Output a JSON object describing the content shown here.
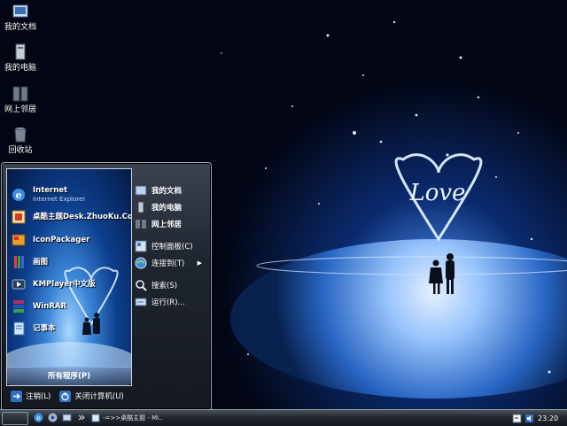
{
  "desktop": {
    "icons": [
      {
        "label": "我的文档",
        "icon": "my-documents-icon"
      },
      {
        "label": "我的电脑",
        "icon": "my-computer-icon"
      },
      {
        "label": "网上邻居",
        "icon": "network-places-icon"
      },
      {
        "label": "回收站",
        "icon": "recycle-bin-icon"
      }
    ],
    "wallpaper_text": "Love"
  },
  "start_menu": {
    "pinned": [
      {
        "name": "Internet",
        "sub": "Internet Explorer",
        "icon": "internet-explorer-icon"
      },
      {
        "name": "桌酷主题Desk.ZhuoKu.Com",
        "icon": "zhuoku-icon"
      },
      {
        "name": "IconPackager",
        "icon": "iconpackager-icon"
      },
      {
        "name": "画图",
        "icon": "paint-icon"
      },
      {
        "name": "KMPlayer中文版",
        "icon": "kmplayer-icon"
      },
      {
        "name": "WinRAR",
        "icon": "winrar-icon"
      },
      {
        "name": "记事本",
        "icon": "notepad-icon"
      }
    ],
    "all_programs": "所有程序(P)",
    "places": [
      {
        "label": "我的文档",
        "icon": "my-documents-icon",
        "bold": true
      },
      {
        "label": "我的电脑",
        "icon": "my-computer-icon",
        "bold": true
      },
      {
        "label": "网上邻居",
        "icon": "network-places-icon",
        "bold": true
      },
      {
        "label": "控制面板(C)",
        "icon": "control-panel-icon"
      },
      {
        "label": "连接到(T)",
        "icon": "connect-to-icon",
        "arrow": "▶"
      },
      {
        "label": "搜索(S)",
        "icon": "search-icon"
      },
      {
        "label": "运行(R)...",
        "icon": "run-icon"
      }
    ],
    "logoff": "注销(L)",
    "shutdown": "关闭计算机(U)"
  },
  "taskbar": {
    "task_label": "-=>>桌酷主题 - Mi...",
    "clock": "23:20"
  }
}
